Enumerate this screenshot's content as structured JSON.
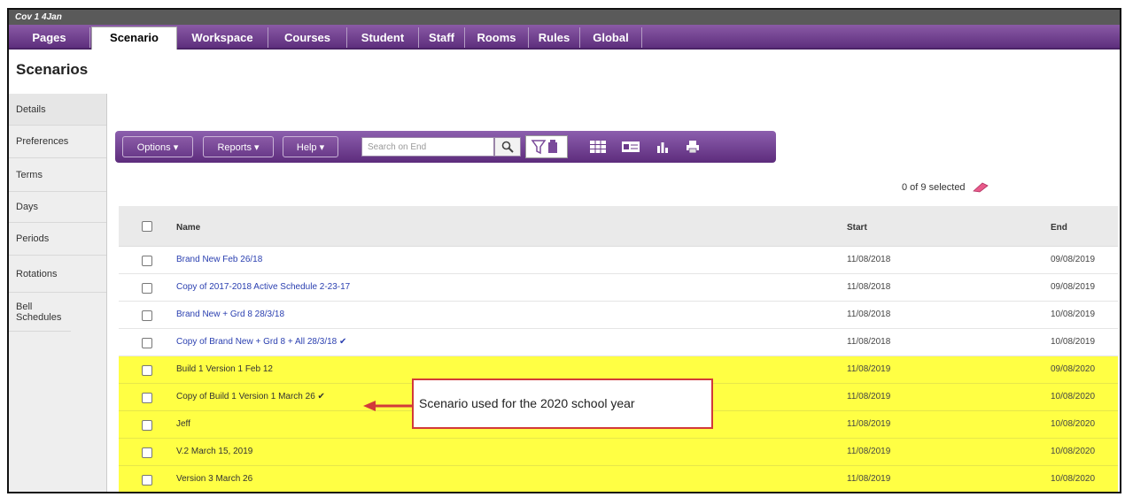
{
  "window": {
    "title": "Cov 1 4Jan"
  },
  "nav": {
    "tabs": [
      "Pages",
      "Scenario",
      "Workspace",
      "Courses",
      "Student",
      "Staff",
      "Rooms",
      "Rules",
      "Global"
    ],
    "active": "Scenario"
  },
  "page": {
    "title": "Scenarios"
  },
  "sidebar": {
    "items": [
      "Details",
      "Preferences",
      "Terms",
      "Days",
      "Periods",
      "Rotations",
      "Bell Schedules"
    ]
  },
  "toolbar": {
    "options_label": "Options ▾",
    "reports_label": "Reports ▾",
    "help_label": "Help ▾",
    "search_placeholder": "Search on End",
    "icons": [
      "search-icon",
      "filter-icon",
      "grid-icon",
      "card-icon",
      "chart-icon",
      "print-icon"
    ]
  },
  "selection": {
    "text": "0 of 9 selected"
  },
  "table": {
    "headers": {
      "name": "Name",
      "start": "Start",
      "end": "End"
    },
    "rows": [
      {
        "name": "Brand New Feb 26/18",
        "start": "11/08/2018",
        "end": "09/08/2019",
        "highlight": false,
        "link": true
      },
      {
        "name": "Copy of 2017-2018 Active Schedule 2-23-17",
        "start": "11/08/2018",
        "end": "09/08/2019",
        "highlight": false,
        "link": true
      },
      {
        "name": "Brand New + Grd 8 28/3/18",
        "start": "11/08/2018",
        "end": "10/08/2019",
        "highlight": false,
        "link": true
      },
      {
        "name": "Copy of Brand New + Grd 8 + All 28/3/18 ✔",
        "start": "11/08/2018",
        "end": "10/08/2019",
        "highlight": false,
        "link": true
      },
      {
        "name": "Build 1 Version 1 Feb 12",
        "start": "11/08/2019",
        "end": "09/08/2020",
        "highlight": true,
        "link": false
      },
      {
        "name": "Copy of Build 1 Version 1 March 26 ✔",
        "start": "11/08/2019",
        "end": "10/08/2020",
        "highlight": true,
        "link": false
      },
      {
        "name": "Jeff",
        "start": "11/08/2019",
        "end": "10/08/2020",
        "highlight": true,
        "link": false
      },
      {
        "name": "V.2 March 15, 2019",
        "start": "11/08/2019",
        "end": "10/08/2020",
        "highlight": true,
        "link": false
      },
      {
        "name": "Version 3 March 26",
        "start": "11/08/2019",
        "end": "10/08/2020",
        "highlight": true,
        "link": false
      }
    ]
  },
  "callout": {
    "text": "Scenario used for the 2020 school year"
  },
  "colors": {
    "nav_purple": "#6a3a8a",
    "highlight": "#ffff44",
    "callout_border": "#d23a3a",
    "link": "#2a3fb0"
  }
}
